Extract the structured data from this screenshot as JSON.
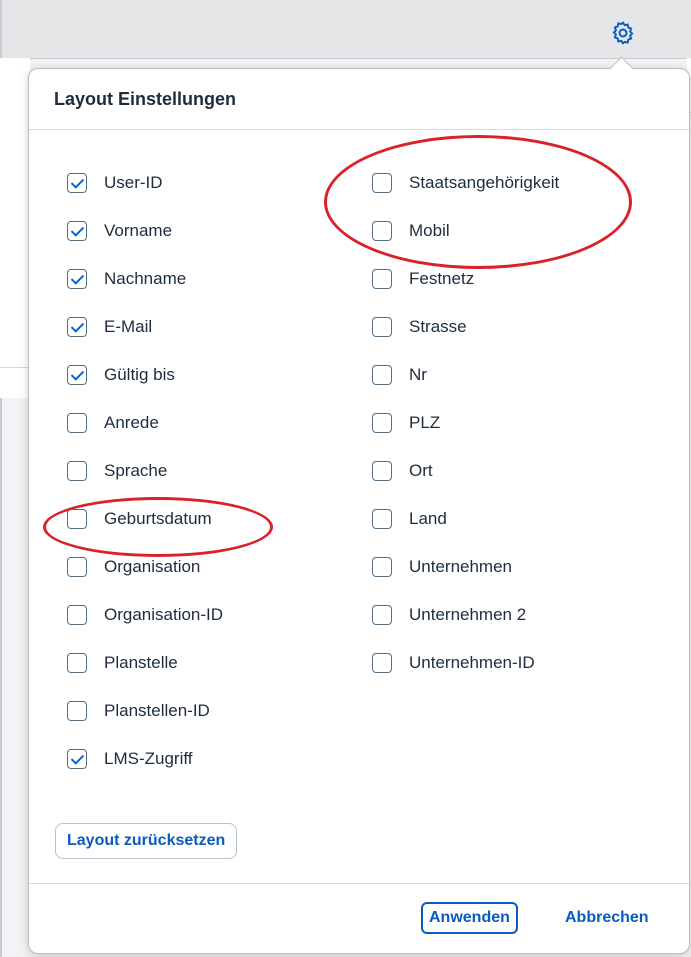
{
  "header": {
    "settings_icon": "gear-icon",
    "accent_color": "#0a5bbf"
  },
  "dialog": {
    "title": "Layout Einstellungen",
    "left_column": [
      {
        "label": "User-ID",
        "checked": true
      },
      {
        "label": "Vorname",
        "checked": true
      },
      {
        "label": "Nachname",
        "checked": true
      },
      {
        "label": "E-Mail",
        "checked": true
      },
      {
        "label": "Gültig bis",
        "checked": true
      },
      {
        "label": "Anrede",
        "checked": false
      },
      {
        "label": "Sprache",
        "checked": false
      },
      {
        "label": "Geburtsdatum",
        "checked": false
      },
      {
        "label": "Organisation",
        "checked": false
      },
      {
        "label": "Organisation-ID",
        "checked": false
      },
      {
        "label": "Planstelle",
        "checked": false
      },
      {
        "label": "Planstellen-ID",
        "checked": false
      },
      {
        "label": "LMS-Zugriff",
        "checked": true
      }
    ],
    "right_column": [
      {
        "label": "Staatsangehörigkeit",
        "checked": false
      },
      {
        "label": "Mobil",
        "checked": false
      },
      {
        "label": "Festnetz",
        "checked": false
      },
      {
        "label": "Strasse",
        "checked": false
      },
      {
        "label": "Nr",
        "checked": false
      },
      {
        "label": "PLZ",
        "checked": false
      },
      {
        "label": "Ort",
        "checked": false
      },
      {
        "label": "Land",
        "checked": false
      },
      {
        "label": "Unternehmen",
        "checked": false
      },
      {
        "label": "Unternehmen 2",
        "checked": false
      },
      {
        "label": "Unternehmen-ID",
        "checked": false
      }
    ],
    "reset_label": "Layout zurücksetzen",
    "apply_label": "Anwenden",
    "cancel_label": "Abbrechen"
  },
  "annotation_color": "#d9222a"
}
